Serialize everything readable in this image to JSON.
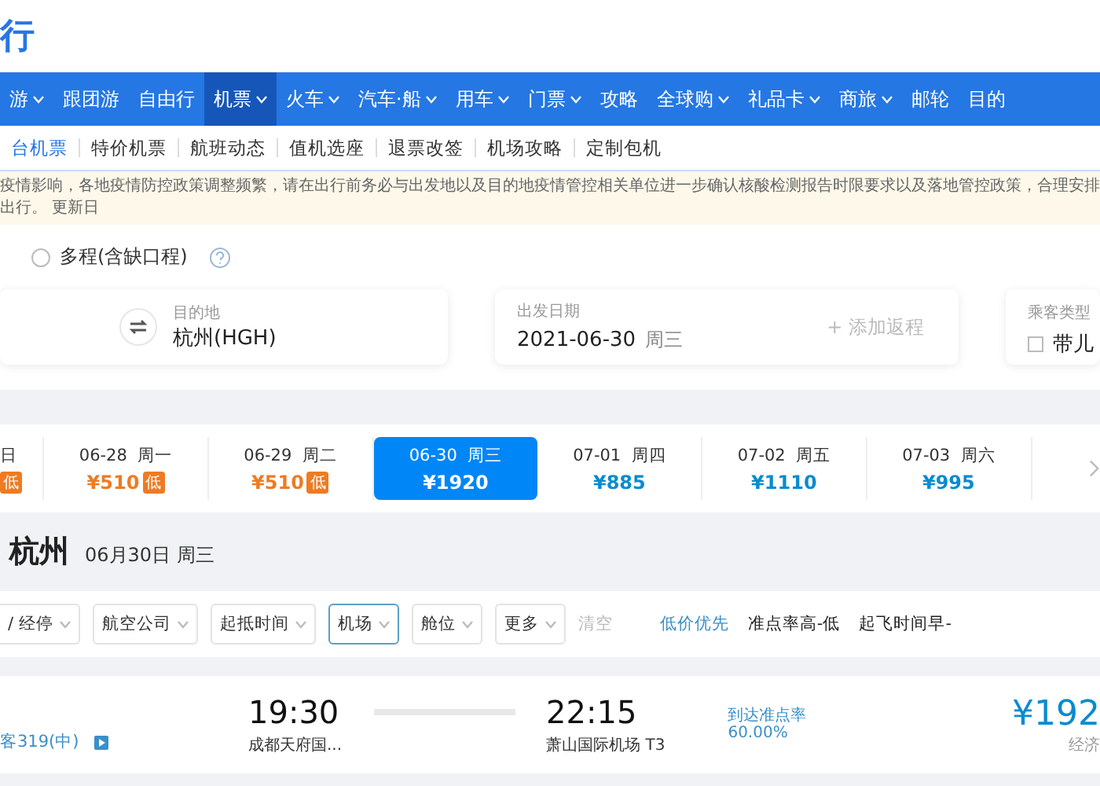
{
  "logo": {
    "text": "行"
  },
  "nav": [
    {
      "label": "游",
      "dropdown": true,
      "selected": false
    },
    {
      "label": "跟团游",
      "dropdown": false,
      "selected": false
    },
    {
      "label": "自由行",
      "dropdown": false,
      "selected": false
    },
    {
      "label": "机票",
      "dropdown": true,
      "selected": true
    },
    {
      "label": "火车",
      "dropdown": true,
      "selected": false
    },
    {
      "label": "汽车·船",
      "dropdown": true,
      "selected": false
    },
    {
      "label": "用车",
      "dropdown": true,
      "selected": false
    },
    {
      "label": "门票",
      "dropdown": true,
      "selected": false
    },
    {
      "label": "攻略",
      "dropdown": false,
      "selected": false
    },
    {
      "label": "全球购",
      "dropdown": true,
      "selected": false
    },
    {
      "label": "礼品卡",
      "dropdown": true,
      "selected": false
    },
    {
      "label": "商旅",
      "dropdown": true,
      "selected": false
    },
    {
      "label": "邮轮",
      "dropdown": false,
      "selected": false
    },
    {
      "label": "目的",
      "dropdown": false,
      "selected": false
    }
  ],
  "subnav": [
    {
      "label": "台机票",
      "selected": true
    },
    {
      "label": "特价机票",
      "selected": false
    },
    {
      "label": "航班动态",
      "selected": false
    },
    {
      "label": "值机选座",
      "selected": false
    },
    {
      "label": "退票改签",
      "selected": false
    },
    {
      "label": "机场攻略",
      "selected": false
    },
    {
      "label": "定制包机",
      "selected": false
    }
  ],
  "notice": "疫情影响，各地疫情防控政策调整频繁，请在出行前务必与出发地以及目的地疫情管控相关单位进一步确认核酸检测报告时限要求以及落地管控政策，合理安排出行。 更新日",
  "trip_type": {
    "label": "多程(含缺口程)",
    "selected": false
  },
  "search": {
    "destination": {
      "label": "目的地",
      "value": "杭州(HGH)"
    },
    "date": {
      "label": "出发日期",
      "value": "2021-06-30",
      "weekday": "周三",
      "return_hint": "+ 添加返程"
    },
    "passenger": {
      "label": "乘客类型",
      "option": "带儿",
      "checked": false
    }
  },
  "dates": [
    {
      "day": "日",
      "low_badge": "低",
      "selected": false
    },
    {
      "day": "06-28  周一",
      "price": "¥510",
      "low_badge": "低",
      "selected": false
    },
    {
      "day": "06-29  周二",
      "price": "¥510",
      "low_badge": "低",
      "selected": false
    },
    {
      "day": "06-30  周三",
      "price": "¥1920",
      "selected": true
    },
    {
      "day": "07-01  周四",
      "price": "¥885",
      "selected": false
    },
    {
      "day": "07-02  周五",
      "price": "¥1110",
      "selected": false
    },
    {
      "day": "07-03  周六",
      "price": "¥995",
      "selected": false
    }
  ],
  "route": {
    "city": "杭州",
    "date": "06月30日 周三"
  },
  "filters": [
    {
      "label": "/ 经停",
      "selected": false
    },
    {
      "label": "航空公司",
      "selected": false
    },
    {
      "label": "起抵时间",
      "selected": false
    },
    {
      "label": "机场",
      "selected": true
    },
    {
      "label": "舱位",
      "selected": false
    },
    {
      "label": "更多",
      "selected": false
    }
  ],
  "clear": "清空",
  "sorts": [
    {
      "label": "低价优先",
      "selected": true
    },
    {
      "label": "准点率高-低",
      "selected": false
    },
    {
      "label": "起飞时间早-",
      "selected": false
    }
  ],
  "flight": {
    "aircraft": "客319(中)",
    "depart_time": "19:30",
    "depart_airport": "成都天府国...",
    "arrive_time": "22:15",
    "arrive_airport": "萧山国际机场 T3",
    "ontime_label": "到达准点率",
    "ontime_value": "60.00%",
    "price": "¥192",
    "cabin": "经济"
  }
}
